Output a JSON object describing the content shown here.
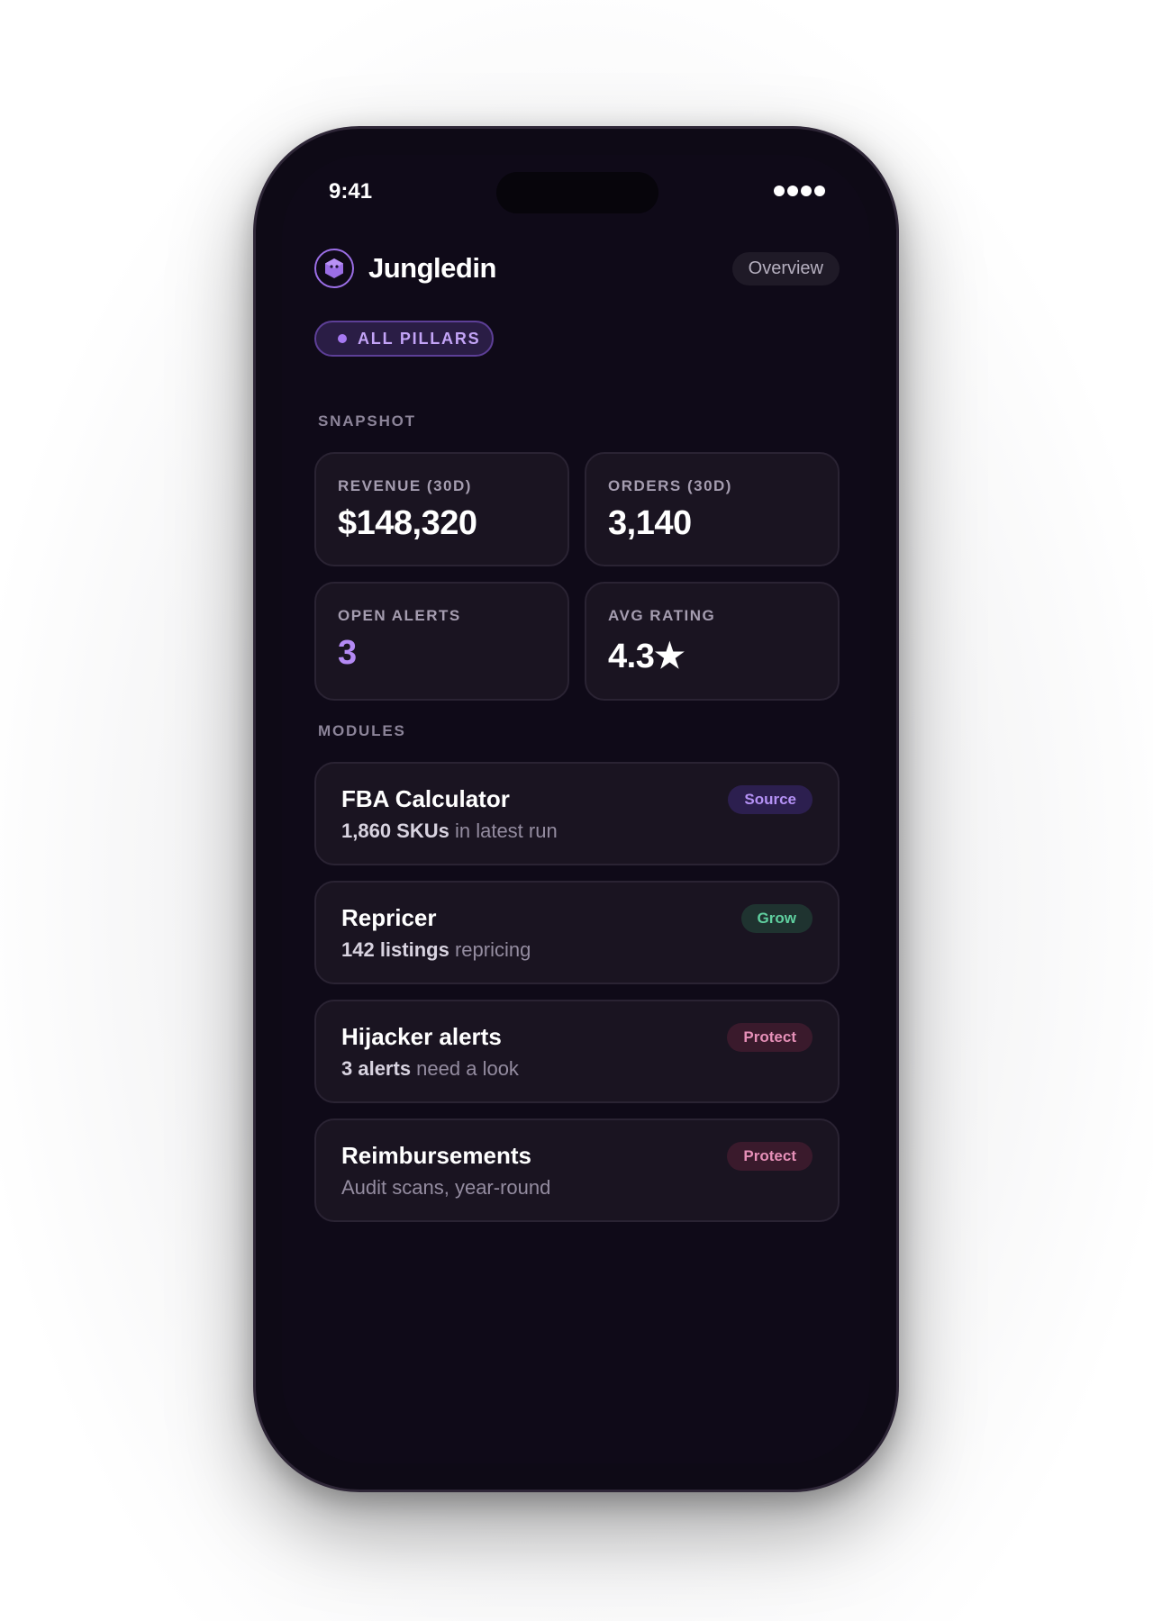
{
  "status_bar": {
    "time": "9:41"
  },
  "header": {
    "brand": "Jungledin",
    "logo_icon": "hexagon-cube-icon",
    "overview_label": "Overview"
  },
  "filter": {
    "pillars_label": "ALL PILLARS"
  },
  "snapshot": {
    "section_label": "SNAPSHOT",
    "stats": [
      {
        "label": "REVENUE (30D)",
        "value": "$148,320"
      },
      {
        "label": "ORDERS (30D)",
        "value": "3,140"
      },
      {
        "label": "OPEN ALERTS",
        "value": "3"
      },
      {
        "label": "AVG RATING",
        "value": "4.3★"
      }
    ]
  },
  "modules": {
    "section_label": "MODULES",
    "items": [
      {
        "title": "FBA Calculator",
        "sub_bold": "1,860 SKUs",
        "sub_rest": " in latest run",
        "badge": "Source"
      },
      {
        "title": "Repricer",
        "sub_bold": "142 listings",
        "sub_rest": " repricing",
        "badge": "Grow"
      },
      {
        "title": "Hijacker alerts",
        "sub_bold": "3 alerts",
        "sub_rest": " need a look",
        "badge": "Protect"
      },
      {
        "title": "Reimbursements",
        "sub_bold": "",
        "sub_rest": "Audit scans, year-round",
        "badge": "Protect"
      }
    ]
  },
  "colors": {
    "accent": "#9b6ee6",
    "alert_value": "#b48af4",
    "badge_source_bg": "#2c1f4f",
    "badge_source_fg": "#b491f5",
    "badge_grow_bg": "#1f3330",
    "badge_grow_fg": "#5fcf9f",
    "badge_protect_bg": "#3a1a2c",
    "badge_protect_fg": "#e58fb7"
  }
}
